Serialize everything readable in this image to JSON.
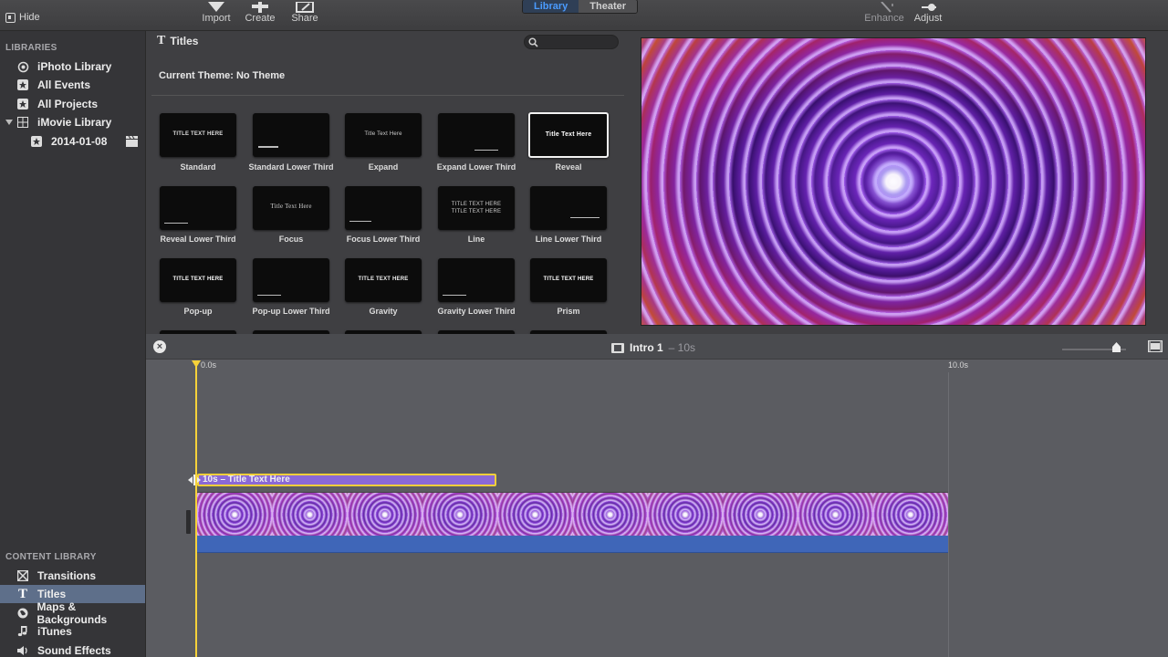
{
  "toolbar": {
    "hide_label": "Hide",
    "import_label": "Import",
    "create_label": "Create",
    "share_label": "Share",
    "library_tab": "Library",
    "theater_tab": "Theater",
    "enhance_label": "Enhance",
    "adjust_label": "Adjust"
  },
  "sidebar": {
    "libraries_header": "LIBRARIES",
    "items": [
      {
        "label": "iPhoto Library",
        "icon": "camera-icon"
      },
      {
        "label": "All Events",
        "icon": "star-icon"
      },
      {
        "label": "All Projects",
        "icon": "star-icon"
      },
      {
        "label": "iMovie Library",
        "icon": "grid-icon"
      },
      {
        "label": "2014-01-08",
        "icon": "star-icon"
      }
    ],
    "content_header": "CONTENT LIBRARY",
    "content_items": [
      {
        "label": "Transitions",
        "icon": "transition-icon"
      },
      {
        "label": "Titles",
        "icon": "title-t-icon"
      },
      {
        "label": "Maps & Backgrounds",
        "icon": "globe-icon"
      },
      {
        "label": "iTunes",
        "icon": "music-note-icon"
      },
      {
        "label": "Sound Effects",
        "icon": "speaker-icon"
      }
    ]
  },
  "browser": {
    "header_icon": "T",
    "header_title": "Titles",
    "theme_label": "Current Theme: No Theme",
    "tiles": [
      {
        "caption": "Standard",
        "preview": "TITLE TEXT HERE"
      },
      {
        "caption": "Standard Lower Third",
        "preview": ""
      },
      {
        "caption": "Expand",
        "preview": "Title Text Here"
      },
      {
        "caption": "Expand Lower Third",
        "preview": ""
      },
      {
        "caption": "Reveal",
        "preview": "Title Text Here"
      },
      {
        "caption": "Reveal Lower Third",
        "preview": ""
      },
      {
        "caption": "Focus",
        "preview": "Title Text Here"
      },
      {
        "caption": "Focus Lower Third",
        "preview": ""
      },
      {
        "caption": "Line",
        "preview": "TITLE TEXT HERE"
      },
      {
        "caption": "Line Lower Third",
        "preview": ""
      },
      {
        "caption": "Pop-up",
        "preview": "TITLE TEXT HERE"
      },
      {
        "caption": "Pop-up Lower Third",
        "preview": ""
      },
      {
        "caption": "Gravity",
        "preview": "TITLE TEXT HERE"
      },
      {
        "caption": "Gravity Lower Third",
        "preview": ""
      },
      {
        "caption": "Prism",
        "preview": "TITLE TEXT HERE"
      }
    ]
  },
  "timeline": {
    "project_name": "Intro 1",
    "project_duration": "– 10s",
    "ruler_start": "0.0s",
    "ruler_end": "10.0s",
    "title_clip_label": "10s – Title Text Here"
  },
  "colors": {
    "accent_blue": "#4a9bff",
    "selection": "#5e6f8a",
    "playhead": "#f6d23a",
    "audio": "#3f66b8",
    "title_clip": "#8a68d6"
  }
}
